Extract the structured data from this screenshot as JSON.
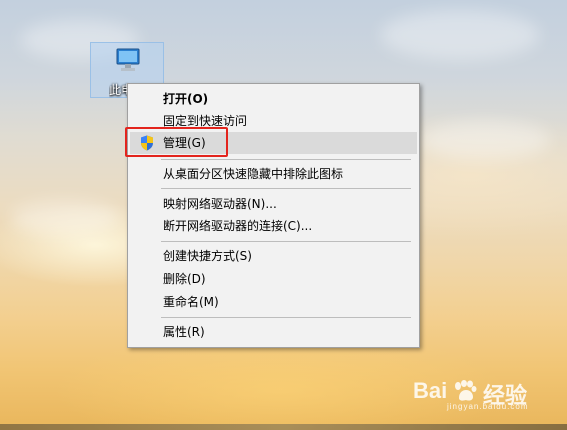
{
  "desktop": {
    "icon_label": "此电脑",
    "icon_name": "computer-icon"
  },
  "context_menu": {
    "items": [
      {
        "label": "打开(O)",
        "bold": true
      },
      {
        "label": "固定到快速访问"
      },
      {
        "label": "管理(G)",
        "icon": "uac-shield-icon",
        "hovered": true,
        "highlighted": true
      },
      {
        "label": "从桌面分区快速隐藏中排除此图标"
      },
      {
        "label": "映射网络驱动器(N)..."
      },
      {
        "label": "断开网络驱动器的连接(C)..."
      },
      {
        "label": "创建快捷方式(S)"
      },
      {
        "label": "删除(D)"
      },
      {
        "label": "重命名(M)"
      },
      {
        "label": "属性(R)"
      }
    ]
  },
  "watermark": {
    "text_left": "Bai",
    "text_right": "经验",
    "sub": "jingyan.baidu.com",
    "icon_name": "baidu-paw-icon"
  },
  "colors": {
    "highlight_box": "#e3241d",
    "menu_background": "#f2f2f2",
    "hover_background": "#dadada"
  }
}
